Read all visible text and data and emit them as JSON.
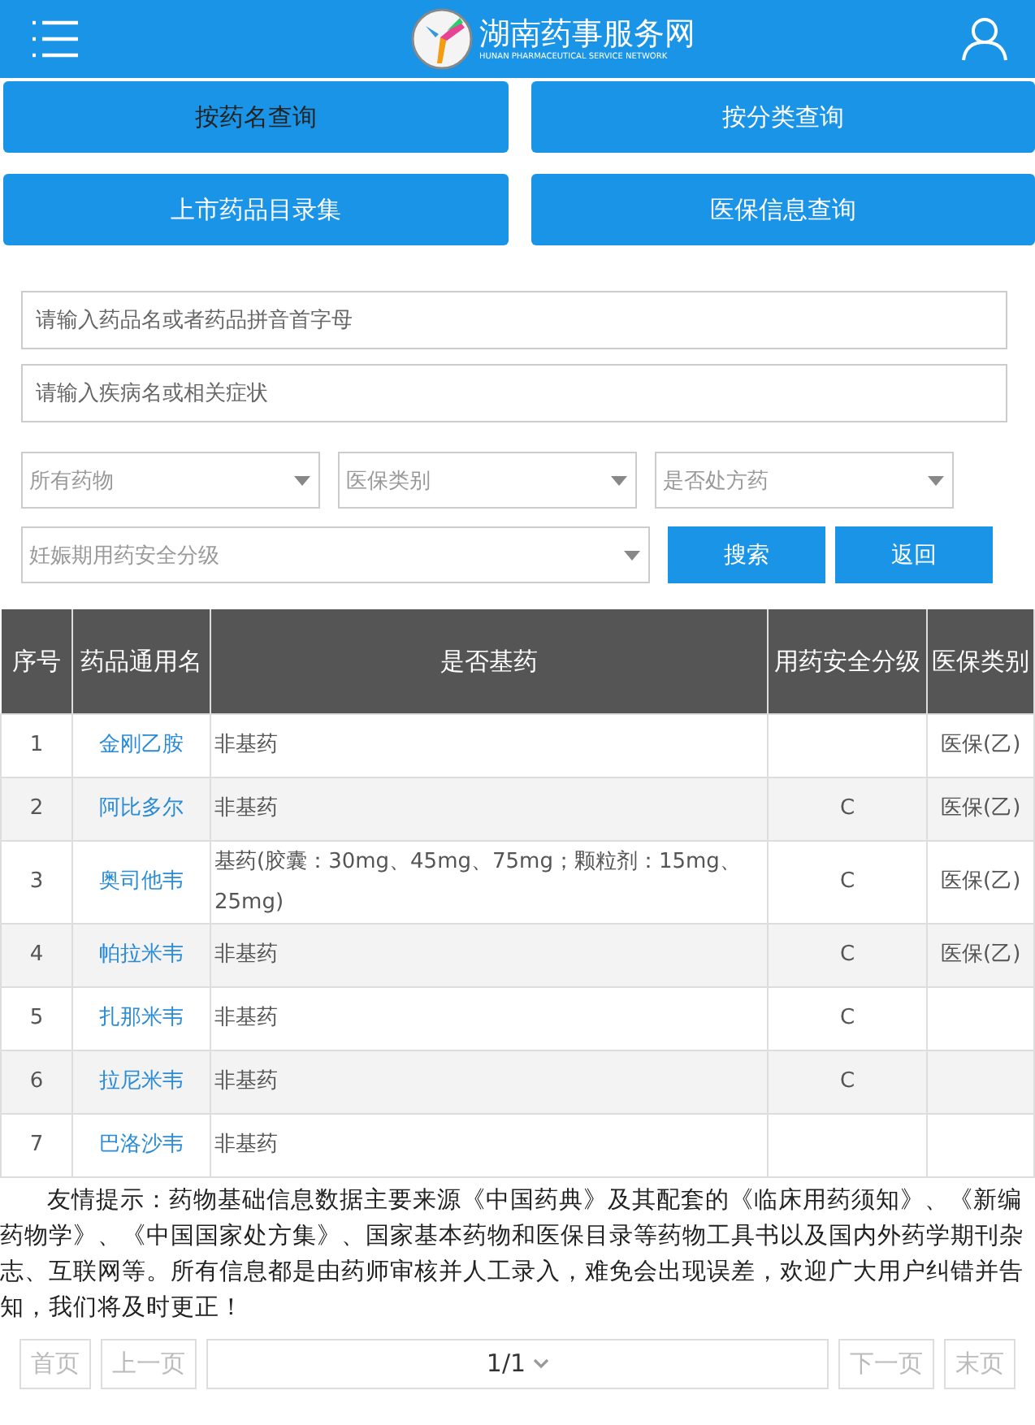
{
  "header": {
    "title": "湖南药事服务网",
    "subtitle": "HUNAN PHARMACEUTICAL SERVICE NETWORK"
  },
  "nav_buttons": [
    {
      "label": "按药名查询",
      "selected": true
    },
    {
      "label": "按分类查询",
      "selected": false
    },
    {
      "label": "上市药品目录集",
      "selected": false
    },
    {
      "label": "医保信息查询",
      "selected": false
    }
  ],
  "search": {
    "drug_name": {
      "placeholder": "请输入药品名或者药品拼音首字母"
    },
    "disease": {
      "placeholder": "请输入疾病名或相关症状"
    },
    "filters": [
      {
        "value": "所有药物"
      },
      {
        "value": "医保类别"
      },
      {
        "value": "是否处方药"
      },
      {
        "value": "妊娠期用药安全分级"
      }
    ],
    "buttons": [
      "搜索",
      "返回"
    ]
  },
  "table": {
    "columns": [
      "序号",
      "药品通用名",
      "是否基药",
      "用药安全分级",
      "医保类别"
    ],
    "rows": [
      [
        "1",
        "金刚乙胺",
        "非基药",
        "",
        "医保(乙)"
      ],
      [
        "2",
        "阿比多尔",
        "非基药",
        "C",
        "医保(乙)"
      ],
      [
        "3",
        "奥司他韦",
        "基药(胶囊：30mg、45mg、75mg；颗粒剂：15mg、25mg)",
        "C",
        "医保(乙)"
      ],
      [
        "4",
        "帕拉米韦",
        "非基药",
        "C",
        "医保(乙)"
      ],
      [
        "5",
        "扎那米韦",
        "非基药",
        "C",
        ""
      ],
      [
        "6",
        "拉尼米韦",
        "非基药",
        "C",
        ""
      ],
      [
        "7",
        "巴洛沙韦",
        "非基药",
        "",
        ""
      ]
    ]
  },
  "notice": "友情提示：药物基础信息数据主要来源《中国药典》及其配套的《临床用药须知》、《新编药物学》、《中国国家处方集》、国家基本药物和医保目录等药物工具书以及国内外药学期刊杂志、互联网等。所有信息都是由药师审核并人工录入，难免会出现误差，欢迎广大用户纠错并告知，我们将及时更正！",
  "pagination": {
    "first": {
      "label": "首页",
      "disabled": true
    },
    "prev": {
      "label": "上一页",
      "disabled": true
    },
    "page": "1/1",
    "next": {
      "label": "下一页",
      "disabled": true
    },
    "last": {
      "label": "末页",
      "disabled": true
    }
  }
}
